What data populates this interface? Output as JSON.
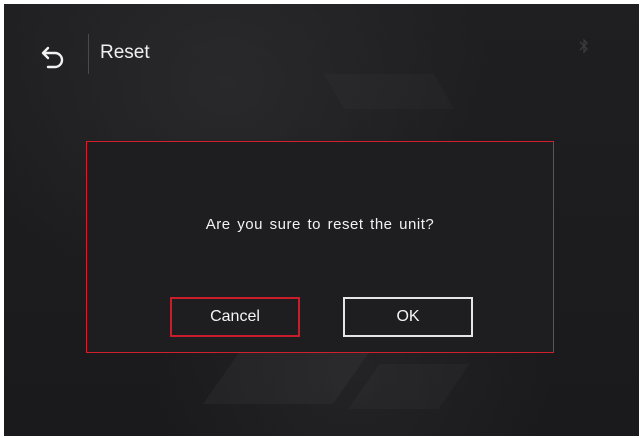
{
  "header": {
    "title": "Reset",
    "back_icon": "back-arrow-icon",
    "status_icon": "bluetooth-icon"
  },
  "dialog": {
    "message": "Are you sure to reset the unit?",
    "cancel_label": "Cancel",
    "ok_label": "OK"
  },
  "colors": {
    "background": "#1c1c1e",
    "accent_red": "#d11f2e",
    "text": "#f0f0f0"
  }
}
